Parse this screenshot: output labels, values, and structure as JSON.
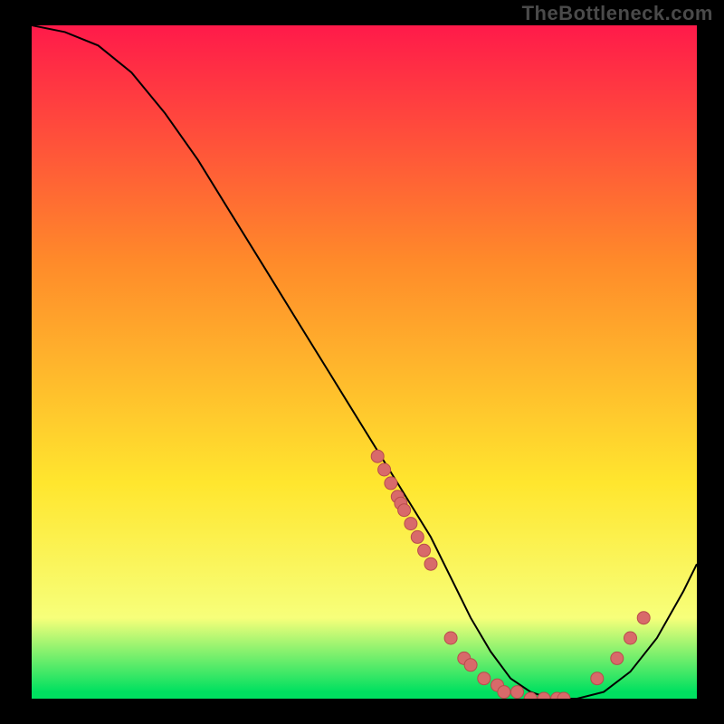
{
  "watermark": "TheBottleneck.com",
  "colors": {
    "background": "#000000",
    "gradient_top": "#ff1a4a",
    "gradient_mid": "#ffd400",
    "gradient_bottom": "#00e060",
    "curve": "#000000",
    "dots": "#d86a6a",
    "dots_stroke": "#b84c4c"
  },
  "chart_data": {
    "type": "line",
    "title": "",
    "xlabel": "",
    "ylabel": "",
    "xlim": [
      0,
      100
    ],
    "ylim": [
      0,
      100
    ],
    "curve": {
      "x": [
        0,
        5,
        10,
        15,
        20,
        25,
        30,
        35,
        40,
        45,
        50,
        55,
        60,
        63,
        66,
        69,
        72,
        75,
        78,
        82,
        86,
        90,
        94,
        98,
        100
      ],
      "y": [
        100,
        99,
        97,
        93,
        87,
        80,
        72,
        64,
        56,
        48,
        40,
        32,
        24,
        18,
        12,
        7,
        3,
        1,
        0,
        0,
        1,
        4,
        9,
        16,
        20
      ]
    },
    "series": [
      {
        "name": "points-left-slope",
        "x": [
          52,
          53,
          54,
          55,
          55.5,
          56,
          57,
          58,
          59,
          60
        ],
        "y": [
          36,
          34,
          32,
          30,
          29,
          28,
          26,
          24,
          22,
          20
        ]
      },
      {
        "name": "points-bottom",
        "x": [
          63,
          65,
          66,
          68,
          70,
          71,
          73,
          75,
          77,
          79,
          80
        ],
        "y": [
          9,
          6,
          5,
          3,
          2,
          1,
          1,
          0,
          0,
          0,
          0
        ]
      },
      {
        "name": "points-right-slope",
        "x": [
          85,
          88,
          90,
          92
        ],
        "y": [
          3,
          6,
          9,
          12
        ]
      }
    ]
  }
}
